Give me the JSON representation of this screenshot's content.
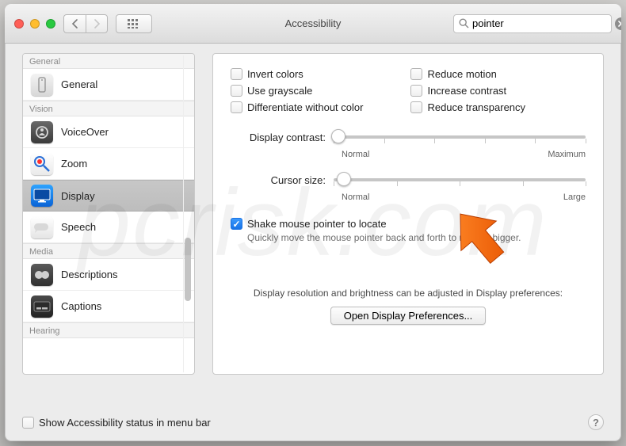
{
  "window": {
    "title": "Accessibility",
    "search_value": "pointer"
  },
  "sidebar": {
    "sections": [
      {
        "header": "General",
        "items": [
          {
            "id": "general",
            "label": "General",
            "icon": "gear"
          }
        ]
      },
      {
        "header": "Vision",
        "items": [
          {
            "id": "voiceover",
            "label": "VoiceOver",
            "icon": "voiceover"
          },
          {
            "id": "zoom",
            "label": "Zoom",
            "icon": "zoom"
          },
          {
            "id": "display",
            "label": "Display",
            "icon": "display",
            "selected": true
          },
          {
            "id": "speech",
            "label": "Speech",
            "icon": "speech"
          }
        ]
      },
      {
        "header": "Media",
        "items": [
          {
            "id": "descriptions",
            "label": "Descriptions",
            "icon": "descriptions"
          },
          {
            "id": "captions",
            "label": "Captions",
            "icon": "captions"
          }
        ]
      },
      {
        "header": "Hearing",
        "items": []
      }
    ]
  },
  "pane": {
    "checks_left": [
      {
        "id": "invert",
        "label": "Invert colors",
        "checked": false
      },
      {
        "id": "gray",
        "label": "Use grayscale",
        "checked": false
      },
      {
        "id": "diffcol",
        "label": "Differentiate without color",
        "checked": false
      }
    ],
    "checks_right": [
      {
        "id": "motion",
        "label": "Reduce motion",
        "checked": false
      },
      {
        "id": "contrastc",
        "label": "Increase contrast",
        "checked": false
      },
      {
        "id": "transp",
        "label": "Reduce transparency",
        "checked": false
      }
    ],
    "contrast": {
      "label": "Display contrast:",
      "min_label": "Normal",
      "max_label": "Maximum",
      "value_pct": 0
    },
    "cursor": {
      "label": "Cursor size:",
      "min_label": "Normal",
      "max_label": "Large",
      "value_pct": 4
    },
    "shake": {
      "label": "Shake mouse pointer to locate",
      "checked": true,
      "sub": "Quickly move the mouse pointer back and forth to make it bigger."
    },
    "resolution_note": "Display resolution and brightness can be adjusted in Display preferences:",
    "open_display_btn": "Open Display Preferences..."
  },
  "bottom": {
    "status_label": "Show Accessibility status in menu bar",
    "status_checked": false
  },
  "watermark": "pcrisk.com",
  "colors": {
    "accent": "#1e7ef0"
  }
}
